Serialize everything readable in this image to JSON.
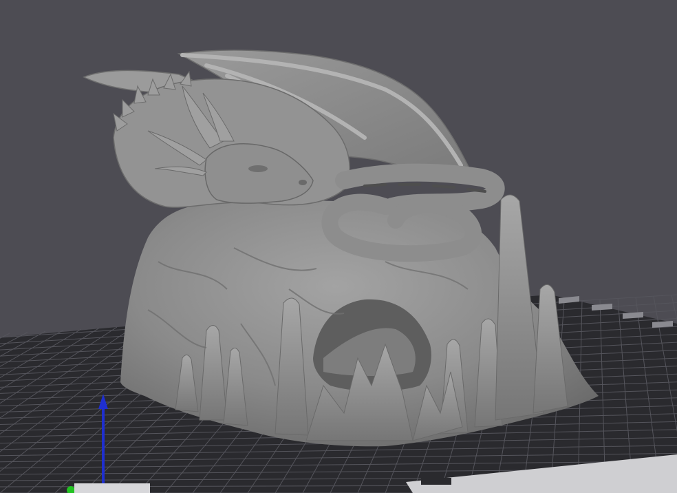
{
  "viewport": {
    "background": "#4d4c53",
    "bed_color": "#2a2a2e",
    "grid_line_color": "#55555c",
    "model_color": "#8c8c8c",
    "axis_z_color": "#1f2fd0",
    "origin_color": "#22c322",
    "bed_label_icon": "printer-bed-logo-icon"
  }
}
